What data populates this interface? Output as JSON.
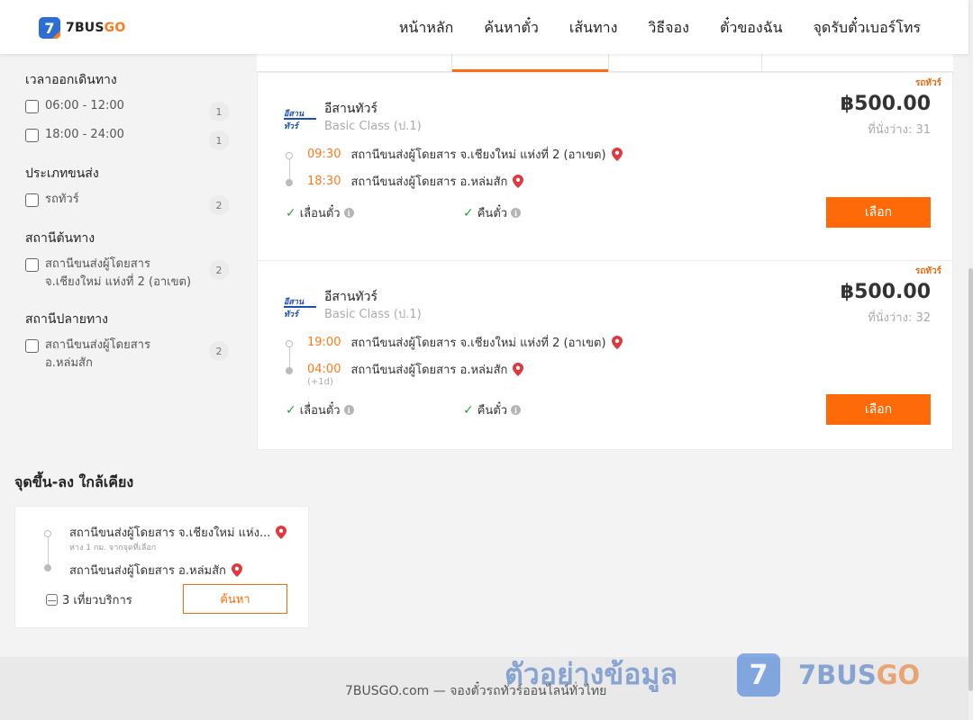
{
  "brand": {
    "name_part1": "7BUS",
    "name_part2": "GO",
    "badge": "7"
  },
  "nav": [
    "หน้าหลัก",
    "ค้นหาตั๋ว",
    "เส้นทาง",
    "วิธีจอง",
    "ตั๋วของฉัน",
    "จุดรับตั๋วเบอร์โทร"
  ],
  "filters": {
    "departure_time": {
      "title": "เวลาออกเดินทาง",
      "options": [
        {
          "label": "06:00 - 12:00",
          "count": "1"
        },
        {
          "label": "18:00 - 24:00",
          "count": "1"
        }
      ]
    },
    "transport_type": {
      "title": "ประเภทขนส่ง",
      "options": [
        {
          "label": "รถทัวร์",
          "count": "2"
        }
      ]
    },
    "origin_station": {
      "title": "สถานีต้นทาง",
      "options": [
        {
          "label": "สถานีขนส่งผู้โดยสาร จ.เชียงใหม่ แห่งที่ 2 (อาเขต)",
          "count": "2"
        }
      ]
    },
    "destination_station": {
      "title": "สถานีปลายทาง",
      "options": [
        {
          "label": "สถานีขนส่งผู้โดยสาร อ.หล่มสัก",
          "count": "2"
        }
      ]
    }
  },
  "trips": [
    {
      "tag": "รถทัวร์",
      "operator_logo_text": "อีสานทัวร์",
      "operator": "อีสานทัวร์",
      "bus_class": "Basic Class (ป.1)",
      "price": "฿500.00",
      "seats": "ที่นั่งว่าง: 31",
      "depart_time": "09:30",
      "depart_station": "สถานีขนส่งผู้โดยสาร จ.เชียงใหม่ แห่งที่ 2 (อาเขต)",
      "arrive_time": "18:30",
      "arrive_station": "สถานีขนส่งผู้โดยสาร อ.หล่มสัก",
      "next_day": "",
      "feature_change": "เลื่อนตั๋ว",
      "feature_refund": "คืนตั๋ว",
      "select_label": "เลือก"
    },
    {
      "tag": "รถทัวร์",
      "operator_logo_text": "อีสานทัวร์",
      "operator": "อีสานทัวร์",
      "bus_class": "Basic Class (ป.1)",
      "price": "฿500.00",
      "seats": "ที่นั่งว่าง: 32",
      "depart_time": "19:00",
      "depart_station": "สถานีขนส่งผู้โดยสาร จ.เชียงใหม่ แห่งที่ 2 (อาเขต)",
      "arrive_time": "04:00",
      "arrive_station": "สถานีขนส่งผู้โดยสาร อ.หล่มสัก",
      "next_day": "(+1d)",
      "feature_change": "เลื่อนตั๋ว",
      "feature_refund": "คืนตั๋ว",
      "select_label": "เลือก"
    }
  ],
  "nearby": {
    "title": "จุดขึ้น-ลง ใกล้เคียง",
    "from_station": "สถานีขนส่งผู้โดยสาร จ.เชียงใหม่ แห่ง...",
    "from_distance": "ห่าง 1 กม. จากจุดที่เลือก",
    "to_station": "สถานีขนส่งผู้โดยสาร อ.หล่มสัก",
    "trips_count": "3 เที่ยวบริการ",
    "search_label": "ค้นหา"
  },
  "footer": {
    "text": "7BUSGO.com — จองตั๋วรถทัวร์ออนไลน์ทั่วไทย"
  },
  "watermark": {
    "text": "ตัวอย่างข้อมูล",
    "logo_badge": "7",
    "logo_part1": "7BUS",
    "logo_part2": "GO"
  },
  "colors": {
    "accent": "#ff6a08",
    "brand_blue": "#2b6fd6",
    "time_orange": "#ff7a1a",
    "check_green": "#2a9d3a",
    "pin_red": "#e0383e"
  }
}
